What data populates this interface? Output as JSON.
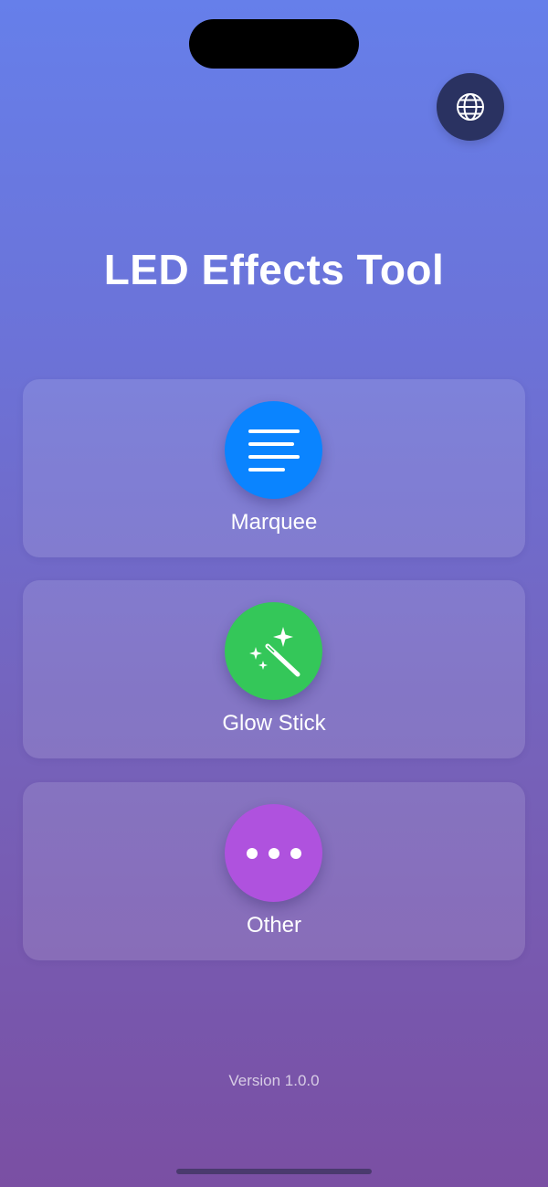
{
  "app": {
    "title": "LED Effects Tool",
    "version": "Version 1.0.0"
  },
  "header": {
    "language_icon": "globe-icon"
  },
  "menu": [
    {
      "label": "Marquee",
      "icon": "text-align-left-icon",
      "color": "#0a84ff"
    },
    {
      "label": "Glow Stick",
      "icon": "magic-wand-icon",
      "color": "#34c759"
    },
    {
      "label": "Other",
      "icon": "ellipsis-icon",
      "color": "#af52de"
    }
  ],
  "theme": {
    "gradient_top": "#667fea",
    "gradient_bottom": "#7a4fa3"
  }
}
